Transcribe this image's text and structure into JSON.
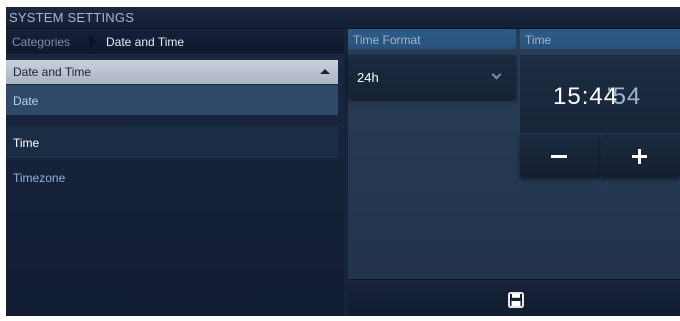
{
  "window": {
    "title": "SYSTEM SETTINGS"
  },
  "breadcrumb": {
    "root": "Categories",
    "current": "Date and Time"
  },
  "category_group": {
    "label": "Date and Time",
    "expanded": true
  },
  "category_items": [
    {
      "label": "Date",
      "state": "highlighted"
    },
    {
      "label": "Time",
      "state": "selected"
    },
    {
      "label": "Timezone",
      "state": "normal"
    }
  ],
  "time_format": {
    "header": "Time Format",
    "value": "24h",
    "icon": "chevron-down-icon"
  },
  "time": {
    "header": "Time",
    "hours_minutes": "15:44",
    "seconds": "'54"
  },
  "stepper": {
    "minus_icon": "minus-icon",
    "plus_icon": "plus-icon"
  },
  "footer": {
    "save_icon": "floppy-disk-icon"
  },
  "colors": {
    "background": "#162338",
    "header_blue": "#2d5b8a",
    "group_header": "#c9d1dc",
    "highlight_row": "#2f4968",
    "link_text": "#8eb3df"
  }
}
